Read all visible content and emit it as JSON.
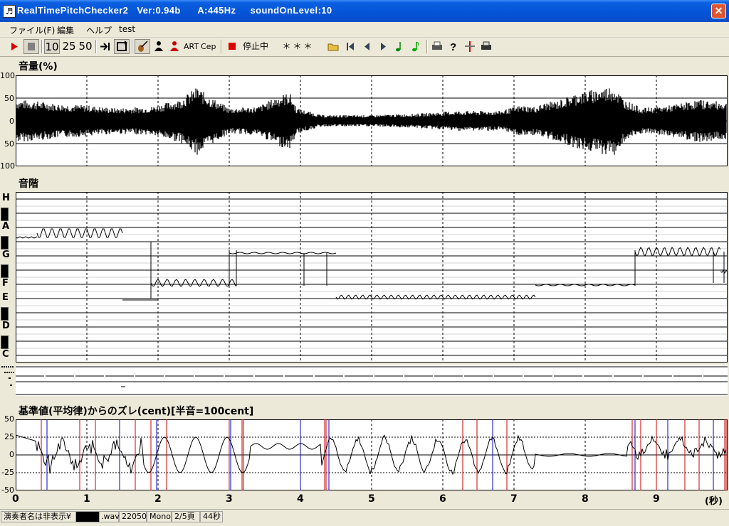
{
  "window": {
    "title": "RealTimePitchChecker2   Ver:0.94b      A:445Hz     soundOnLevel:10",
    "close_icon": "close-x"
  },
  "menu": [
    "ファイル(F)",
    "編集",
    "ヘルプ",
    "test"
  ],
  "toolbar": {
    "step_labels": [
      "10",
      "25",
      "50"
    ],
    "art_label": "ART",
    "cep_label": "Cep",
    "state_label": "停止中",
    "note_display": "＊＊＊",
    "icons": [
      "play-icon",
      "stop-icon",
      "skip-end-icon",
      "loop-icon",
      "violin-icon",
      "person-black-icon",
      "person-red-icon",
      "record-icon",
      "folder-open-icon",
      "first-page-icon",
      "prev-page-icon",
      "next-page-icon",
      "note-icon",
      "note2-icon",
      "print-icon",
      "help-icon",
      "split-icon",
      "printer2-icon"
    ]
  },
  "volume_panel": {
    "title": "音量(%)",
    "y_ticks": [
      "100",
      "50",
      "0",
      "50",
      "100"
    ]
  },
  "scale_panel": {
    "title": "音階",
    "notes": [
      "H",
      "A",
      "G",
      "F",
      "E",
      "D",
      "C"
    ]
  },
  "deviation_panel": {
    "title": "基準値(平均律)からのズレ(cent)[半音=100cent]",
    "y_ticks": [
      "50",
      "25",
      "0",
      "-25",
      "-50"
    ]
  },
  "time_axis": {
    "ticks": [
      "0",
      "1",
      "2",
      "3",
      "4",
      "5",
      "6",
      "7",
      "8",
      "9"
    ],
    "unit": "(秒)"
  },
  "status": {
    "performer": "演奏者名は非表示¥",
    "file_suffix": ".wav",
    "sample_rate": "22050",
    "channels": "Mono",
    "page": "2/5頁",
    "duration": "44秒"
  },
  "colors": {
    "titlebar": "#0a5fe0",
    "waveform": "#000000",
    "pitch_marker_red": "#cc0000",
    "pitch_marker_blue": "#0000cc"
  }
}
